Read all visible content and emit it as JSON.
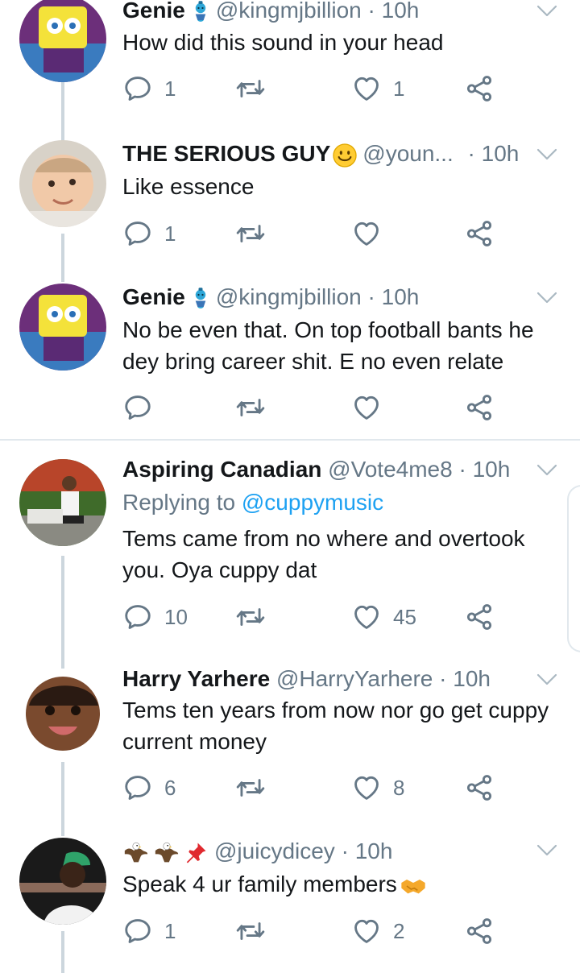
{
  "colors": {
    "text": "#14171a",
    "muted": "#657786",
    "link": "#1da1f2",
    "thread": "#ccd6dd"
  },
  "tweets": [
    {
      "name": "Genie",
      "emoji": "genie",
      "handle": "@kingmjbillion",
      "time": "· 10h",
      "body": "How did this sound in your head",
      "replies": "1",
      "retweets": "",
      "likes": "1"
    },
    {
      "name": "THE SERIOUS GUY",
      "emoji": "smile",
      "handle": "@youn...",
      "time": "· 10h",
      "body": "Like essence",
      "replies": "1",
      "retweets": "",
      "likes": ""
    },
    {
      "name": "Genie",
      "emoji": "genie",
      "handle": "@kingmjbillion",
      "time": "· 10h",
      "body": "No be even that. On top football bants he dey bring career shit. E no even relate",
      "replies": "",
      "retweets": "",
      "likes": ""
    },
    {
      "name": "Aspiring Canadian",
      "emoji": "",
      "handle": "@Vote4me8",
      "time": "· 10h",
      "replying_prefix": "Replying to",
      "replying_to": "@cuppymusic",
      "body": "Tems came from no where and overtook you. Oya cuppy dat",
      "replies": "10",
      "retweets": "",
      "likes": "45"
    },
    {
      "name": "Harry Yarhere",
      "emoji": "",
      "handle": "@HarryYarhere",
      "time": "· 10h",
      "body": "Tems ten years from now nor go get cuppy current money",
      "replies": "6",
      "retweets": "",
      "likes": "8"
    },
    {
      "name": "",
      "emoji": "eagles-pin",
      "handle": "@juicydicey",
      "time": "· 10h",
      "body": "Speak 4 ur family members",
      "replies": "1",
      "retweets": "",
      "likes": "2"
    }
  ]
}
